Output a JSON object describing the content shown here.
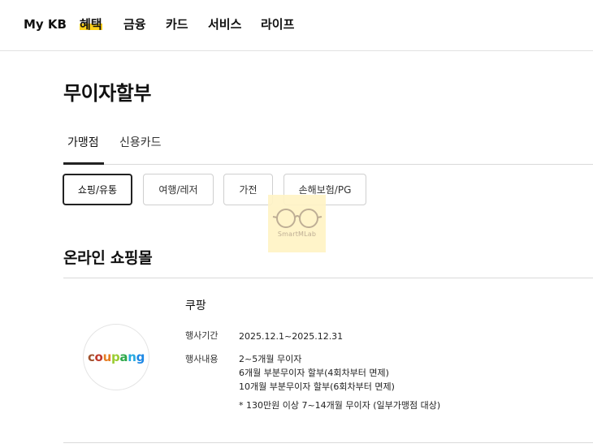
{
  "nav": {
    "items": [
      {
        "label": "My KB"
      },
      {
        "label": "혜택"
      },
      {
        "label": "금융"
      },
      {
        "label": "카드"
      },
      {
        "label": "서비스"
      },
      {
        "label": "라이프"
      }
    ],
    "active_index": 1,
    "highlight_color": "#ffd21a"
  },
  "page": {
    "title": "무이자할부"
  },
  "tabs": [
    {
      "label": "가맹점",
      "active": true
    },
    {
      "label": "신용카드",
      "active": false
    }
  ],
  "filters": [
    {
      "label": "쇼핑/유통",
      "active": true
    },
    {
      "label": "여행/레저",
      "active": false
    },
    {
      "label": "가전",
      "active": false
    },
    {
      "label": "손해보험/PG",
      "active": false
    }
  ],
  "watermark": {
    "text": "SmartMLab",
    "icon": "glasses-icon"
  },
  "section": {
    "title": "온라인 쇼핑몰"
  },
  "merchant": {
    "name": "쿠팡",
    "logo_text": "coupang",
    "logo_letters": [
      {
        "char": "c",
        "color": "#a0522d"
      },
      {
        "char": "o",
        "color": "#c0392b"
      },
      {
        "char": "u",
        "color": "#e67e22"
      },
      {
        "char": "p",
        "color": "#9acd32"
      },
      {
        "char": "a",
        "color": "#2ea84a"
      },
      {
        "char": "n",
        "color": "#26a9e0"
      },
      {
        "char": "g",
        "color": "#1e88e5"
      }
    ],
    "period_label": "행사기간",
    "period_value": "2025.12.1~2025.12.31",
    "content_label": "행사내용",
    "content_lines": [
      "2~5개월 무이자",
      "6개월 부분무이자 할부(4회차부터 면제)",
      "10개월 부분무이자 할부(6회차부터 면제)"
    ],
    "note": "* 130만원 이상 7~14개월 무이자 (일부가맹점 대상)"
  }
}
